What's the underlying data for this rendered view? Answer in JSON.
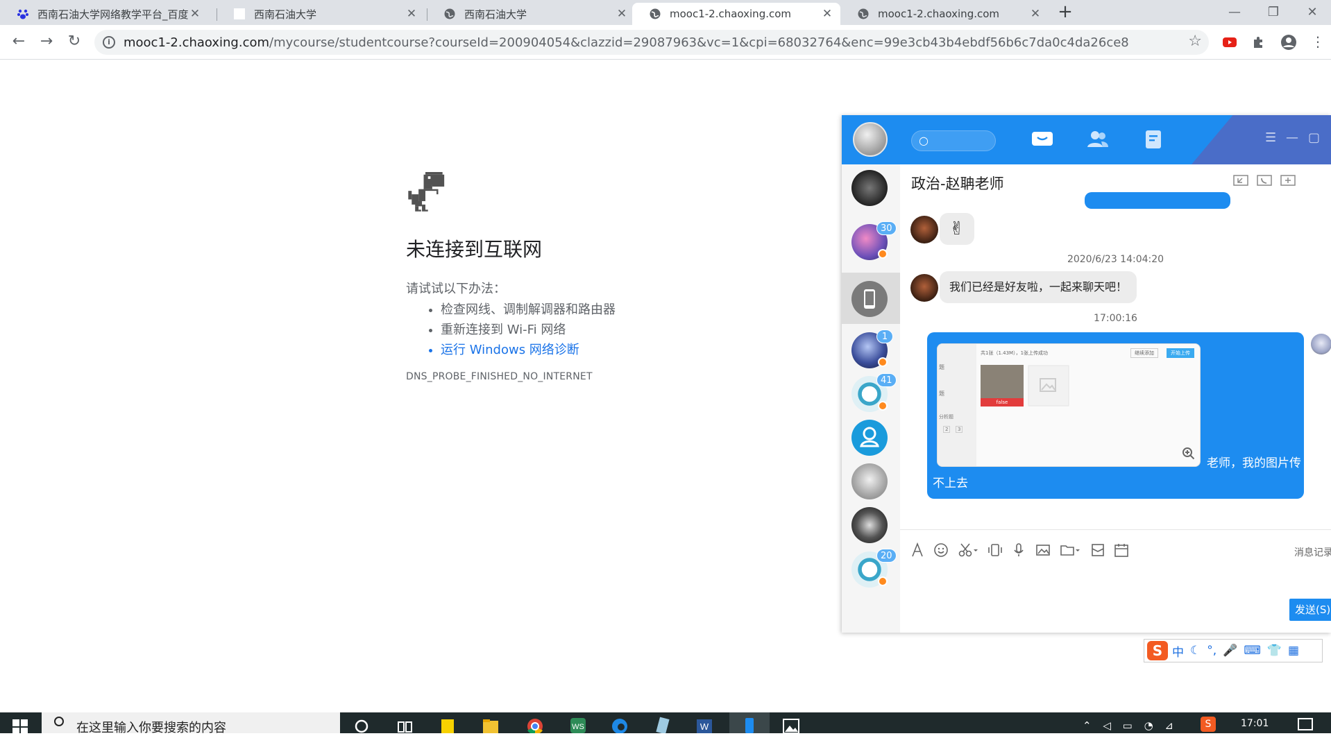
{
  "browser": {
    "tabs": [
      {
        "title": "西南石油大学网络教学平台_百度",
        "favicon": "baidu-paw-icon",
        "active": false
      },
      {
        "title": "西南石油大学",
        "favicon": "blank-page-icon",
        "active": false
      },
      {
        "title": "西南石油大学",
        "favicon": "globe-icon",
        "active": false
      },
      {
        "title": "mooc1-2.chaoxing.com",
        "favicon": "globe-icon",
        "active": true
      },
      {
        "title": "mooc1-2.chaoxing.com",
        "favicon": "globe-icon",
        "active": false
      }
    ],
    "url_host": "mooc1-2.chaoxing.com",
    "url_path": "/mycourse/studentcourse?courseId=200904054&clazzid=29087963&vc=1&cpi=68032764&enc=99e3cb43b4ebdf56b6c7da0c4da26ce8"
  },
  "offline": {
    "heading": "未连接到互联网",
    "suggest_heading": "请试试以下办法：",
    "suggestions": [
      "检查网线、调制解调器和路由器",
      "重新连接到 Wi-Fi 网络"
    ],
    "diagnose_link": "运行 Windows 网络诊断",
    "error_code": "DNS_PROBE_FINISHED_NO_INTERNET"
  },
  "chat": {
    "title": "政治-赵聃老师",
    "contacts": [
      {
        "badge": ""
      },
      {
        "badge": "30"
      },
      {
        "badge": ""
      },
      {
        "badge": "1"
      },
      {
        "badge": "41"
      },
      {
        "badge": ""
      },
      {
        "badge": ""
      },
      {
        "badge": ""
      },
      {
        "badge": "20"
      }
    ],
    "messages": {
      "emoji": "✌",
      "time1": "2020/6/23 14:04:20",
      "friend_text": "我们已经是好友啦，一起来聊天吧！",
      "time2": "17:00:16",
      "my_text_line1": "老师，我的图片传",
      "my_text_line2": "不上去",
      "screenshot_caption": "共1张（1.43M），1张上传成功",
      "screenshot_btn1": "继续添加",
      "screenshot_btn2": "开始上传",
      "screenshot_side1": "题",
      "screenshot_side2": "题",
      "screenshot_side3": "分析题",
      "screenshot_fail": "false",
      "screenshot_pages": [
        "2",
        "3"
      ]
    },
    "history_label": "消息记录",
    "send_label": "发送(S)"
  },
  "ime": {
    "logo": "S",
    "items": [
      "中",
      "☾",
      "°,",
      "🎤",
      "⌨",
      "👕",
      "▦"
    ]
  },
  "taskbar": {
    "search_placeholder": "在这里输入你要搜索的内容",
    "clock_time": "17:01"
  },
  "colors": {
    "accent": "#1d8cf0",
    "link": "#1a73e8",
    "ime": "#f35b22"
  }
}
